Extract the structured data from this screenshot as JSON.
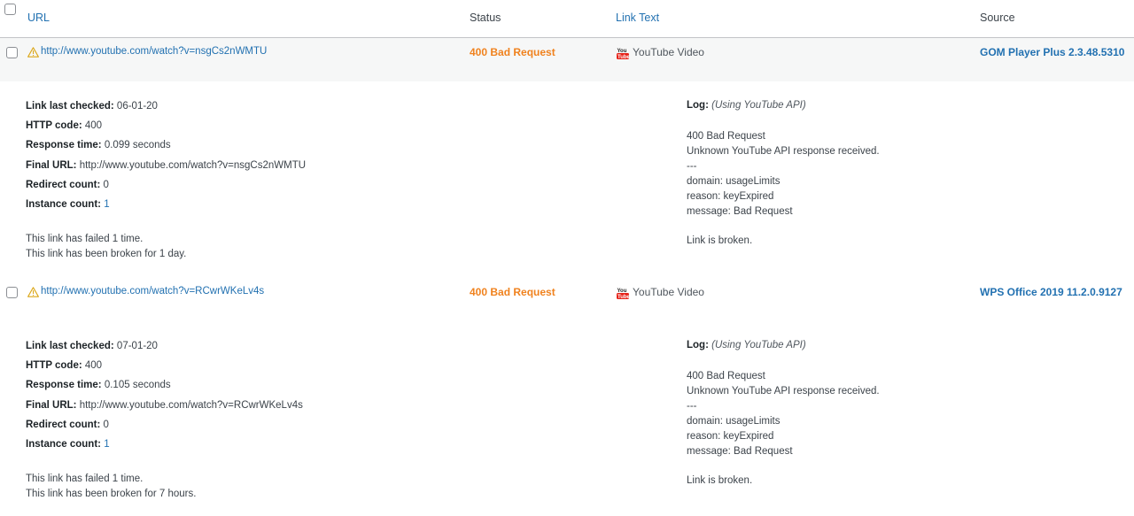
{
  "header": {
    "col_url": "URL",
    "col_status": "Status",
    "col_link_text": "Link Text",
    "col_source": "Source"
  },
  "rows": [
    {
      "url": "http://www.youtube.com/watch?v=nsgCs2nWMTU",
      "status": "400 Bad Request",
      "link_text": "YouTube Video",
      "source": "GOM Player Plus 2.3.48.5310",
      "details": {
        "last_checked_label": "Link last checked:",
        "last_checked": "06-01-20",
        "http_code_label": "HTTP code:",
        "http_code": "400",
        "response_time_label": "Response time:",
        "response_time": "0.099 seconds",
        "final_url_label": "Final URL:",
        "final_url": "http://www.youtube.com/watch?v=nsgCs2nWMTU",
        "redirect_count_label": "Redirect count:",
        "redirect_count": "0",
        "instance_count_label": "Instance count:",
        "instance_count": "1",
        "failed_text": "This link has failed 1 time.",
        "broken_text": "This link has been broken for 1 day."
      },
      "log": {
        "label": "Log:",
        "note": "(Using YouTube API)",
        "lines": [
          "400 Bad Request",
          "Unknown YouTube API response received.",
          "---",
          "domain: usageLimits",
          "reason: keyExpired",
          "message: Bad Request"
        ],
        "summary": "Link is broken."
      }
    },
    {
      "url": "http://www.youtube.com/watch?v=RCwrWKeLv4s",
      "status": "400 Bad Request",
      "link_text": "YouTube Video",
      "source": "WPS Office 2019 11.2.0.9127",
      "details": {
        "last_checked_label": "Link last checked:",
        "last_checked": "07-01-20",
        "http_code_label": "HTTP code:",
        "http_code": "400",
        "response_time_label": "Response time:",
        "response_time": "0.105 seconds",
        "final_url_label": "Final URL:",
        "final_url": "http://www.youtube.com/watch?v=RCwrWKeLv4s",
        "redirect_count_label": "Redirect count:",
        "redirect_count": "0",
        "instance_count_label": "Instance count:",
        "instance_count": "1",
        "failed_text": "This link has failed 1 time.",
        "broken_text": "This link has been broken for 7 hours."
      },
      "log": {
        "label": "Log:",
        "note": "(Using YouTube API)",
        "lines": [
          "400 Bad Request",
          "Unknown YouTube API response received.",
          "---",
          "domain: usageLimits",
          "reason: keyExpired",
          "message: Bad Request"
        ],
        "summary": "Link is broken."
      }
    }
  ],
  "colors": {
    "link": "#2271b1",
    "status_warning": "#f0821e",
    "youtube_red": "#e62117"
  },
  "icons": {
    "warning": "warning-icon",
    "youtube": "youtube-icon"
  }
}
